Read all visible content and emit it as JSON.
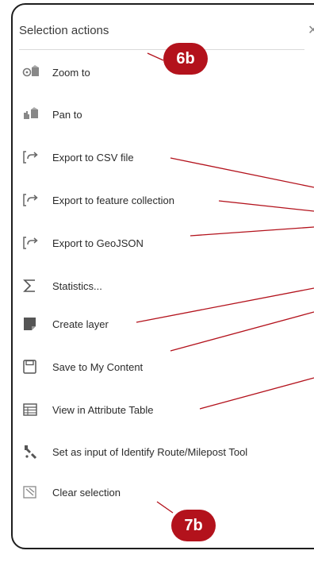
{
  "panel": {
    "title": "Selection actions",
    "close_icon": "close-icon"
  },
  "items": [
    {
      "label": "Zoom to",
      "icon": "zoom-to-icon"
    },
    {
      "label": "Pan to",
      "icon": "pan-to-icon"
    },
    {
      "label": "Export to CSV file",
      "icon": "export-icon"
    },
    {
      "label": "Export to feature collection",
      "icon": "export-icon"
    },
    {
      "label": "Export to GeoJSON",
      "icon": "export-icon"
    },
    {
      "label": "Statistics...",
      "icon": "sigma-icon"
    },
    {
      "label": "Create layer",
      "icon": "layer-icon"
    },
    {
      "label": "Save to My Content",
      "icon": "save-icon"
    },
    {
      "label": "View in Attribute Table",
      "icon": "table-icon"
    },
    {
      "label": "Set as input of Identify Route/Milepost Tool",
      "icon": "route-tool-icon"
    },
    {
      "label": "Clear selection",
      "icon": "clear-selection-icon"
    }
  ],
  "callouts": {
    "badge_top": "6b",
    "badge_bottom": "7b",
    "color": "#b3121c"
  }
}
